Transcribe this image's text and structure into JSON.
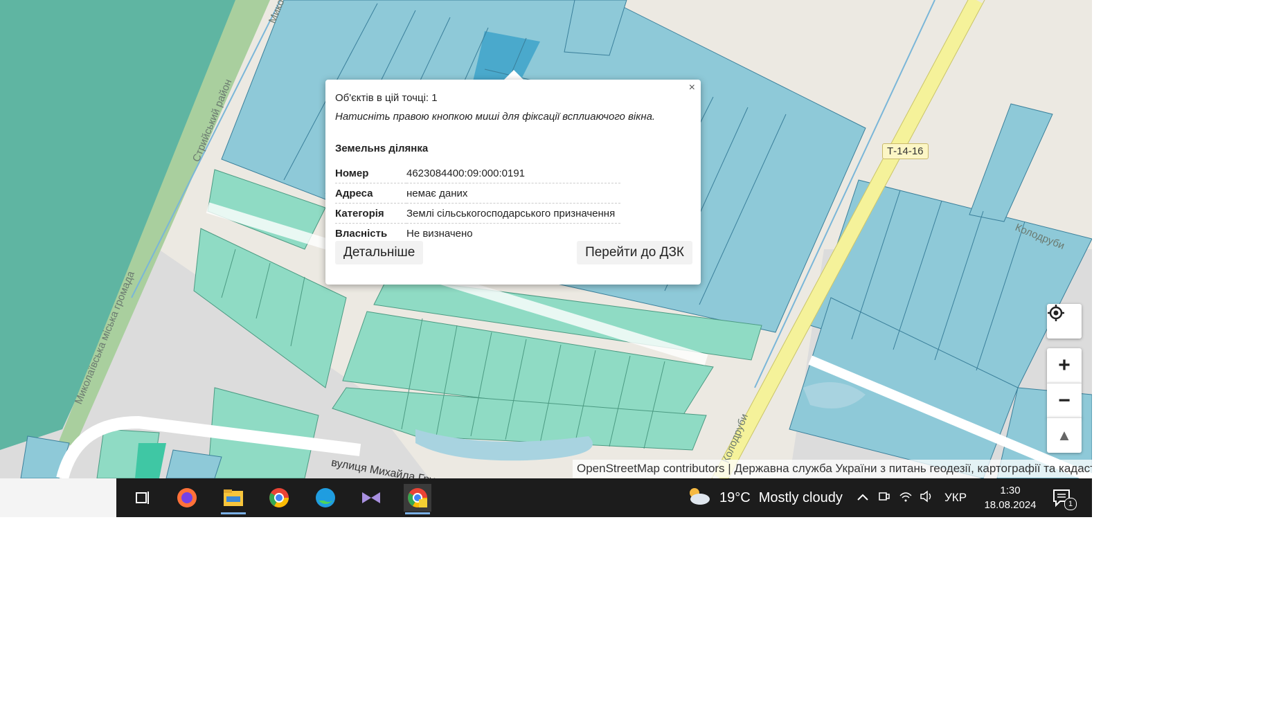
{
  "popup": {
    "count_text": "Об'єктів в цій точці: 1",
    "hint_text": "Натисніть правою кнопкою миші для фіксації всплиаючого вікна.",
    "close_symbol": "×",
    "section_title": "Земельнs ділянка",
    "rows": [
      {
        "key": "Номер",
        "value": "4623084400:09:000:0191"
      },
      {
        "key": "Адреса",
        "value": "немає даних"
      },
      {
        "key": "Категорія",
        "value": "Землі сільськогосподарського призначення"
      },
      {
        "key": "Власність",
        "value": "Не визначено"
      }
    ],
    "details_button": "Детальніше",
    "dzk_button": "Перейти до ДЗК"
  },
  "map": {
    "road_label": "Т-14-16",
    "labels": {
      "district": "Стрийський район",
      "community": "Миколаївська міська громада",
      "street": "вулиця Михайла Гру",
      "village_right": "Колодруби",
      "village_bottom": "Колодруби",
      "top_left": "Мико"
    },
    "attribution": {
      "osm": "OpenStreetMap contributors",
      "separator": "|",
      "dzk": "Державна служба України з питань геодезії, картографії та кадастру"
    },
    "controls": {
      "locate_icon": "locate-icon",
      "zoom_in": "+",
      "zoom_out": "−",
      "north": "▲"
    },
    "colors": {
      "parcel_blue": "#8ec9d8",
      "parcel_blue_selected": "#4aa9cc",
      "parcel_green": "#8fdbc4",
      "forest": "#5fb5a2",
      "road_yellow": "#f5f29a"
    }
  },
  "taskbar": {
    "icons": [
      "task-view-icon",
      "firefox-icon",
      "file-explorer-icon",
      "chrome-icon",
      "edge-icon",
      "visual-studio-icon",
      "chrome-profile-icon"
    ],
    "weather": {
      "temp": "19°C",
      "desc": "Mostly cloudy"
    },
    "language": "УКР",
    "time": "1:30",
    "date": "18.08.2024",
    "notification_count": "1"
  }
}
